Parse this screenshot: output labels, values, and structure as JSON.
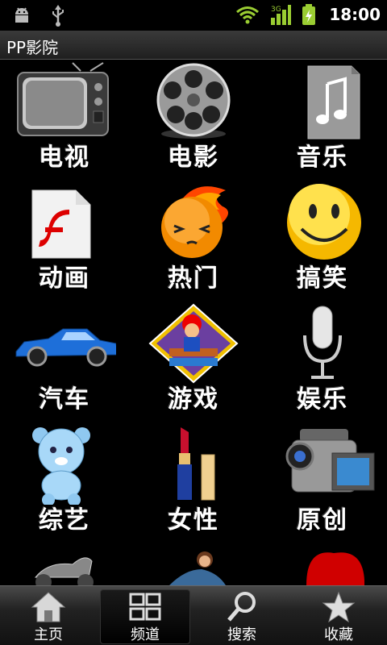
{
  "status_bar": {
    "time": "18:00",
    "icons": [
      "android-debug-icon",
      "usb-icon",
      "wifi-icon",
      "signal-3g-icon",
      "battery-charging-icon"
    ]
  },
  "app": {
    "title": "PP影院"
  },
  "channels": [
    {
      "label": "电视",
      "icon": "tv-icon"
    },
    {
      "label": "电影",
      "icon": "film-reel-icon"
    },
    {
      "label": "音乐",
      "icon": "music-note-icon"
    },
    {
      "label": "动画",
      "icon": "flash-file-icon"
    },
    {
      "label": "热门",
      "icon": "fire-face-icon"
    },
    {
      "label": "搞笑",
      "icon": "smiley-icon"
    },
    {
      "label": "汽车",
      "icon": "car-icon"
    },
    {
      "label": "游戏",
      "icon": "mario-game-icon"
    },
    {
      "label": "娱乐",
      "icon": "microphone-icon"
    },
    {
      "label": "综艺",
      "icon": "teddy-bear-icon"
    },
    {
      "label": "女性",
      "icon": "lipstick-icon"
    },
    {
      "label": "原创",
      "icon": "camcorder-icon"
    },
    {
      "label": "",
      "icon": "motorcycle-icon"
    },
    {
      "label": "",
      "icon": "mermaid-icon"
    },
    {
      "label": "",
      "icon": "red-heart-icon"
    }
  ],
  "tabs": [
    {
      "label": "主页",
      "icon": "home-icon",
      "active": false
    },
    {
      "label": "频道",
      "icon": "grid-icon",
      "active": true
    },
    {
      "label": "搜索",
      "icon": "search-icon",
      "active": false
    },
    {
      "label": "收藏",
      "icon": "star-icon",
      "active": false
    }
  ]
}
